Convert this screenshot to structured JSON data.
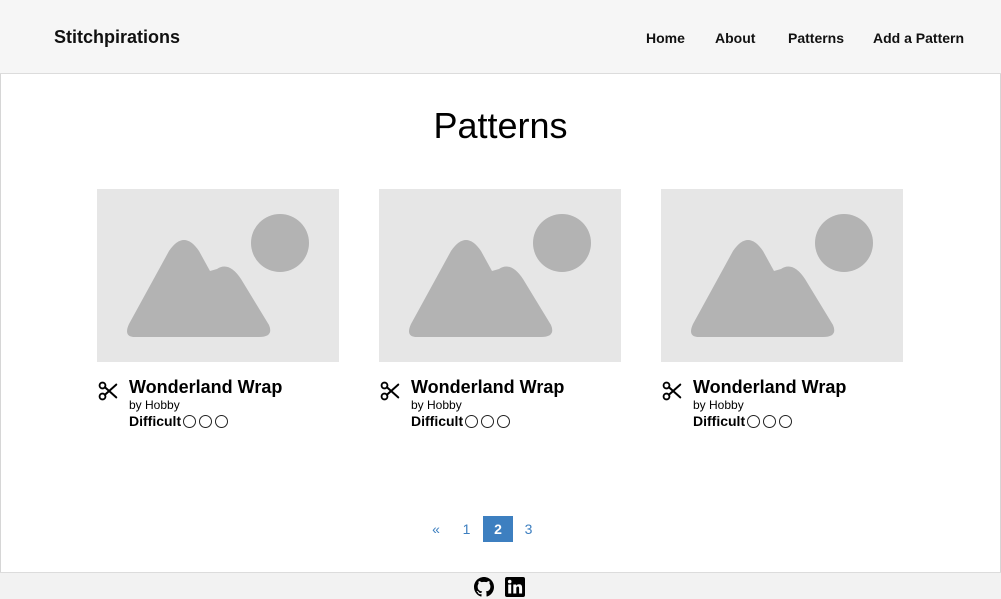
{
  "brand": "Stitchpirations",
  "nav": {
    "items": [
      {
        "label": "Home"
      },
      {
        "label": "About"
      },
      {
        "label": "Patterns"
      },
      {
        "label": "Add a Pattern"
      }
    ]
  },
  "page_title": "Patterns",
  "cards": [
    {
      "title": "Wonderland Wrap",
      "author": "by Hobby",
      "difficulty_label": "Difficult",
      "difficulty_level": 0,
      "difficulty_max": 3,
      "icon": "scissors-icon"
    },
    {
      "title": "Wonderland Wrap",
      "author": "by Hobby",
      "difficulty_label": "Difficult",
      "difficulty_level": 0,
      "difficulty_max": 3,
      "icon": "scissors-icon"
    },
    {
      "title": "Wonderland Wrap",
      "author": "by Hobby",
      "difficulty_label": "Difficult",
      "difficulty_level": 0,
      "difficulty_max": 3,
      "icon": "scissors-icon"
    }
  ],
  "pagination": {
    "prev": "«",
    "pages": [
      "1",
      "2",
      "3"
    ],
    "current": "2"
  },
  "footer": {
    "icons": [
      "github-icon",
      "linkedin-icon"
    ]
  },
  "colors": {
    "accent": "#3d7fc0",
    "placeholder_bg": "#e6e6e6",
    "placeholder_shape": "#b3b3b3",
    "navbar_bg": "#f6f6f6"
  }
}
